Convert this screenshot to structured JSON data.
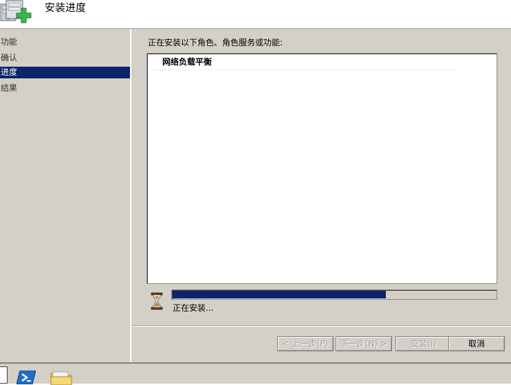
{
  "header": {
    "title": "安装进度",
    "icon": "server-add-icon"
  },
  "sidebar": {
    "items": [
      {
        "label": "功能",
        "active": false
      },
      {
        "label": "确认",
        "active": false
      },
      {
        "label": "进度",
        "active": true
      },
      {
        "label": "结果",
        "active": false
      }
    ]
  },
  "main": {
    "label": "正在安装以下角色、角色服务或功能:",
    "roles": [
      "网络负载平衡"
    ],
    "progress": {
      "value": 0.66,
      "status": "正在安装..."
    },
    "icons": {
      "status": "hourglass-icon"
    }
  },
  "buttons": {
    "previous": "< 上一步(P)",
    "next": "下一步(N) >",
    "install": "安装(I)",
    "cancel": "取消"
  },
  "taskbar": {
    "icons": [
      "powershell-icon",
      "folder-icon"
    ]
  },
  "colors": {
    "selection": "#0a246a",
    "progress": "#0a246a",
    "dialog_face": "#d4d0c8",
    "plus_green": "#39b54a"
  }
}
